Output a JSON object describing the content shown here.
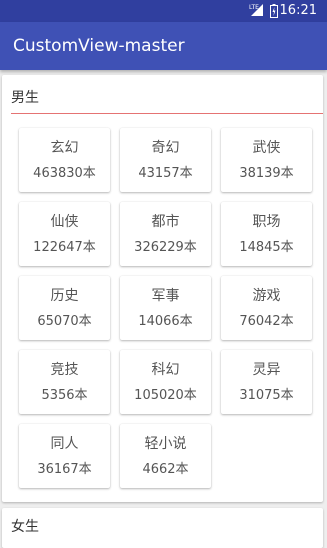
{
  "status_bar": {
    "network": "LTE",
    "time": "16:21"
  },
  "app_bar": {
    "title": "CustomView-master"
  },
  "sections": [
    {
      "title": "男生",
      "categories": [
        {
          "name": "玄幻",
          "count": "463830本"
        },
        {
          "name": "奇幻",
          "count": "43157本"
        },
        {
          "name": "武侠",
          "count": "38139本"
        },
        {
          "name": "仙侠",
          "count": "122647本"
        },
        {
          "name": "都市",
          "count": "326229本"
        },
        {
          "name": "职场",
          "count": "14845本"
        },
        {
          "name": "历史",
          "count": "65070本"
        },
        {
          "name": "军事",
          "count": "14066本"
        },
        {
          "name": "游戏",
          "count": "76042本"
        },
        {
          "name": "竞技",
          "count": "5356本"
        },
        {
          "name": "科幻",
          "count": "105020本"
        },
        {
          "name": "灵异",
          "count": "31075本"
        },
        {
          "name": "同人",
          "count": "36167本"
        },
        {
          "name": "轻小说",
          "count": "4662本"
        }
      ]
    },
    {
      "title": "女生"
    }
  ],
  "colors": {
    "status_bar": "#303f9f",
    "app_bar": "#3f51b5",
    "divider": "#e57373",
    "background": "#eeeeee"
  }
}
